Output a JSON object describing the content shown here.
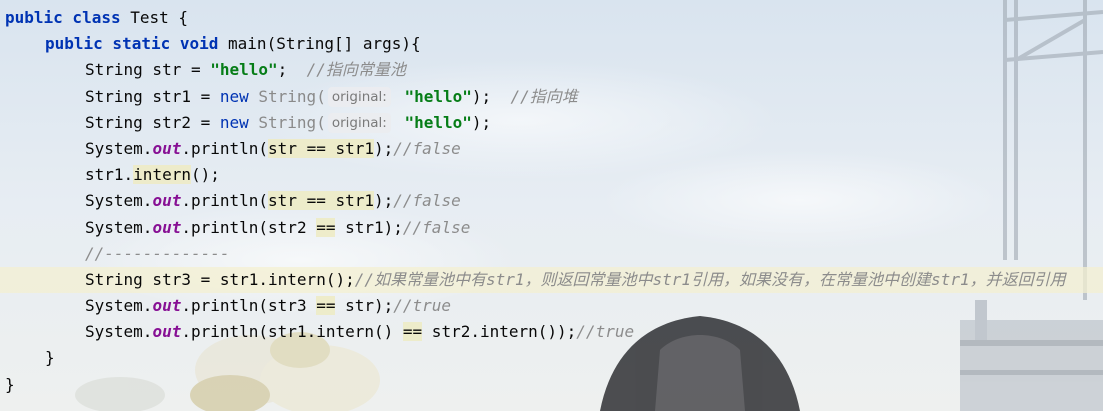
{
  "editor": {
    "lines": [
      {
        "id": "l1",
        "parts": [
          [
            "kw",
            "public class "
          ],
          [
            "",
            "Test {"
          ]
        ]
      },
      {
        "id": "l2",
        "indent": 1,
        "parts": [
          [
            "kw",
            "public static void "
          ],
          [
            "",
            "main(String[] args){"
          ]
        ]
      },
      {
        "id": "l3",
        "indent": 2,
        "parts": [
          [
            "",
            "String str = "
          ],
          [
            "str",
            "\"hello\""
          ],
          [
            "",
            ";  "
          ],
          [
            "cmt",
            "//指向常量池"
          ]
        ]
      },
      {
        "id": "l4",
        "indent": 2,
        "parts": [
          [
            "",
            "String str1 = "
          ],
          [
            "kw2",
            "new "
          ],
          [
            "gray",
            "String("
          ],
          [
            "hint",
            "original:"
          ],
          [
            "str",
            " \"hello\""
          ],
          [
            "",
            ");  "
          ],
          [
            "cmt",
            "//指向堆"
          ]
        ]
      },
      {
        "id": "l5",
        "indent": 2,
        "parts": [
          [
            "",
            "String str2 = "
          ],
          [
            "kw2",
            "new "
          ],
          [
            "gray",
            "String("
          ],
          [
            "hint",
            "original:"
          ],
          [
            "str",
            " \"hello\""
          ],
          [
            "",
            ");"
          ]
        ]
      },
      {
        "id": "l6",
        "indent": 2,
        "parts": [
          [
            "",
            "System."
          ],
          [
            "field",
            "out"
          ],
          [
            "",
            ".println("
          ],
          [
            "hl",
            "str == str1"
          ],
          [
            "",
            ");"
          ],
          [
            "cmt",
            "//false"
          ]
        ]
      },
      {
        "id": "l7",
        "indent": 2,
        "parts": [
          [
            "",
            "str1."
          ],
          [
            "hl",
            "intern"
          ],
          [
            "",
            "();"
          ]
        ]
      },
      {
        "id": "l8",
        "indent": 2,
        "parts": [
          [
            "",
            "System."
          ],
          [
            "field",
            "out"
          ],
          [
            "",
            ".println("
          ],
          [
            "hl",
            "str == str1"
          ],
          [
            "",
            ");"
          ],
          [
            "cmt",
            "//false"
          ]
        ]
      },
      {
        "id": "l9",
        "indent": 2,
        "parts": [
          [
            "",
            "System."
          ],
          [
            "field",
            "out"
          ],
          [
            "",
            ".println(str2 "
          ],
          [
            "hl",
            "=="
          ],
          [
            "",
            " str1);"
          ],
          [
            "cmt",
            "//false"
          ]
        ]
      },
      {
        "id": "l10",
        "indent": 2,
        "parts": [
          [
            "cmt",
            "//-------------"
          ]
        ]
      },
      {
        "id": "l11",
        "indent": 2,
        "current": true,
        "parts": [
          [
            "",
            "String str3 = str1.intern();"
          ],
          [
            "cmt",
            "//如果常量池中有str1，则返回常量池中str1引用，如果没有，在常量池中创建str1，并返回引用"
          ]
        ]
      },
      {
        "id": "l12",
        "indent": 2,
        "parts": [
          [
            "",
            "System."
          ],
          [
            "field",
            "out"
          ],
          [
            "",
            ".println(str3 "
          ],
          [
            "hl",
            "=="
          ],
          [
            "",
            " str);"
          ],
          [
            "cmt",
            "//true"
          ]
        ]
      },
      {
        "id": "l13",
        "indent": 2,
        "parts": [
          [
            "",
            "System."
          ],
          [
            "field",
            "out"
          ],
          [
            "",
            ".println(str1.intern() "
          ],
          [
            "hl",
            "=="
          ],
          [
            "",
            " str2.intern());"
          ],
          [
            "cmt",
            "//true"
          ]
        ]
      },
      {
        "id": "l14",
        "indent": 1,
        "parts": [
          [
            "",
            "}"
          ]
        ]
      },
      {
        "id": "l15",
        "parts": [
          [
            "",
            "}"
          ]
        ]
      }
    ]
  },
  "colors": {
    "keyword": "#0033b3",
    "string": "#067d17",
    "field": "#871094",
    "comment": "#8c8c8c",
    "current_line": "#f4f0d0",
    "highlight": "#edebc5"
  }
}
